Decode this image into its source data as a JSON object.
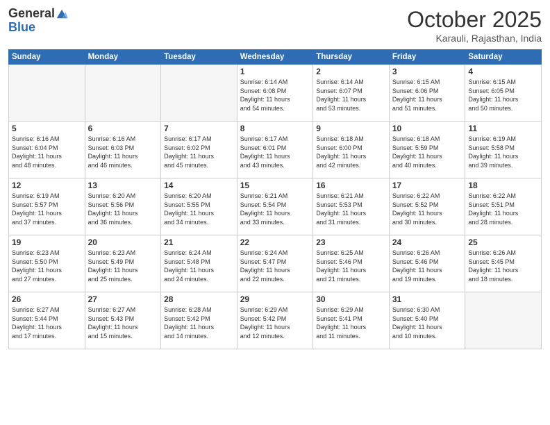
{
  "header": {
    "logo_general": "General",
    "logo_blue": "Blue",
    "month_title": "October 2025",
    "location": "Karauli, Rajasthan, India"
  },
  "weekdays": [
    "Sunday",
    "Monday",
    "Tuesday",
    "Wednesday",
    "Thursday",
    "Friday",
    "Saturday"
  ],
  "weeks": [
    [
      {
        "day": "",
        "info": ""
      },
      {
        "day": "",
        "info": ""
      },
      {
        "day": "",
        "info": ""
      },
      {
        "day": "1",
        "info": "Sunrise: 6:14 AM\nSunset: 6:08 PM\nDaylight: 11 hours\nand 54 minutes."
      },
      {
        "day": "2",
        "info": "Sunrise: 6:14 AM\nSunset: 6:07 PM\nDaylight: 11 hours\nand 53 minutes."
      },
      {
        "day": "3",
        "info": "Sunrise: 6:15 AM\nSunset: 6:06 PM\nDaylight: 11 hours\nand 51 minutes."
      },
      {
        "day": "4",
        "info": "Sunrise: 6:15 AM\nSunset: 6:05 PM\nDaylight: 11 hours\nand 50 minutes."
      }
    ],
    [
      {
        "day": "5",
        "info": "Sunrise: 6:16 AM\nSunset: 6:04 PM\nDaylight: 11 hours\nand 48 minutes."
      },
      {
        "day": "6",
        "info": "Sunrise: 6:16 AM\nSunset: 6:03 PM\nDaylight: 11 hours\nand 46 minutes."
      },
      {
        "day": "7",
        "info": "Sunrise: 6:17 AM\nSunset: 6:02 PM\nDaylight: 11 hours\nand 45 minutes."
      },
      {
        "day": "8",
        "info": "Sunrise: 6:17 AM\nSunset: 6:01 PM\nDaylight: 11 hours\nand 43 minutes."
      },
      {
        "day": "9",
        "info": "Sunrise: 6:18 AM\nSunset: 6:00 PM\nDaylight: 11 hours\nand 42 minutes."
      },
      {
        "day": "10",
        "info": "Sunrise: 6:18 AM\nSunset: 5:59 PM\nDaylight: 11 hours\nand 40 minutes."
      },
      {
        "day": "11",
        "info": "Sunrise: 6:19 AM\nSunset: 5:58 PM\nDaylight: 11 hours\nand 39 minutes."
      }
    ],
    [
      {
        "day": "12",
        "info": "Sunrise: 6:19 AM\nSunset: 5:57 PM\nDaylight: 11 hours\nand 37 minutes."
      },
      {
        "day": "13",
        "info": "Sunrise: 6:20 AM\nSunset: 5:56 PM\nDaylight: 11 hours\nand 36 minutes."
      },
      {
        "day": "14",
        "info": "Sunrise: 6:20 AM\nSunset: 5:55 PM\nDaylight: 11 hours\nand 34 minutes."
      },
      {
        "day": "15",
        "info": "Sunrise: 6:21 AM\nSunset: 5:54 PM\nDaylight: 11 hours\nand 33 minutes."
      },
      {
        "day": "16",
        "info": "Sunrise: 6:21 AM\nSunset: 5:53 PM\nDaylight: 11 hours\nand 31 minutes."
      },
      {
        "day": "17",
        "info": "Sunrise: 6:22 AM\nSunset: 5:52 PM\nDaylight: 11 hours\nand 30 minutes."
      },
      {
        "day": "18",
        "info": "Sunrise: 6:22 AM\nSunset: 5:51 PM\nDaylight: 11 hours\nand 28 minutes."
      }
    ],
    [
      {
        "day": "19",
        "info": "Sunrise: 6:23 AM\nSunset: 5:50 PM\nDaylight: 11 hours\nand 27 minutes."
      },
      {
        "day": "20",
        "info": "Sunrise: 6:23 AM\nSunset: 5:49 PM\nDaylight: 11 hours\nand 25 minutes."
      },
      {
        "day": "21",
        "info": "Sunrise: 6:24 AM\nSunset: 5:48 PM\nDaylight: 11 hours\nand 24 minutes."
      },
      {
        "day": "22",
        "info": "Sunrise: 6:24 AM\nSunset: 5:47 PM\nDaylight: 11 hours\nand 22 minutes."
      },
      {
        "day": "23",
        "info": "Sunrise: 6:25 AM\nSunset: 5:46 PM\nDaylight: 11 hours\nand 21 minutes."
      },
      {
        "day": "24",
        "info": "Sunrise: 6:26 AM\nSunset: 5:46 PM\nDaylight: 11 hours\nand 19 minutes."
      },
      {
        "day": "25",
        "info": "Sunrise: 6:26 AM\nSunset: 5:45 PM\nDaylight: 11 hours\nand 18 minutes."
      }
    ],
    [
      {
        "day": "26",
        "info": "Sunrise: 6:27 AM\nSunset: 5:44 PM\nDaylight: 11 hours\nand 17 minutes."
      },
      {
        "day": "27",
        "info": "Sunrise: 6:27 AM\nSunset: 5:43 PM\nDaylight: 11 hours\nand 15 minutes."
      },
      {
        "day": "28",
        "info": "Sunrise: 6:28 AM\nSunset: 5:42 PM\nDaylight: 11 hours\nand 14 minutes."
      },
      {
        "day": "29",
        "info": "Sunrise: 6:29 AM\nSunset: 5:42 PM\nDaylight: 11 hours\nand 12 minutes."
      },
      {
        "day": "30",
        "info": "Sunrise: 6:29 AM\nSunset: 5:41 PM\nDaylight: 11 hours\nand 11 minutes."
      },
      {
        "day": "31",
        "info": "Sunrise: 6:30 AM\nSunset: 5:40 PM\nDaylight: 11 hours\nand 10 minutes."
      },
      {
        "day": "",
        "info": ""
      }
    ]
  ]
}
